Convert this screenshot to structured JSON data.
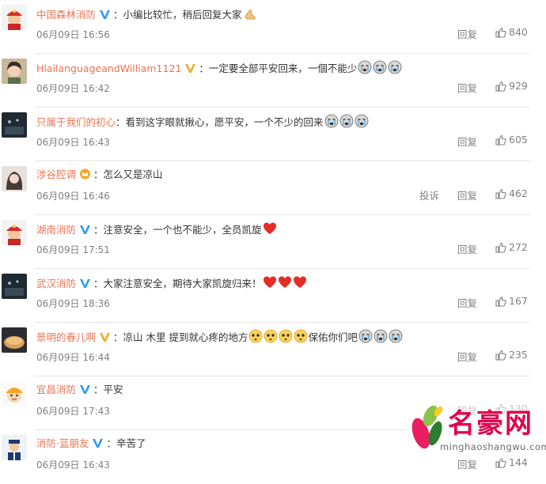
{
  "comments": [
    {
      "user": "中国森林消防",
      "verified": "blue",
      "text": "：小编比较忙，稍后回复大家",
      "emoji": [
        "pray"
      ],
      "time": "06月09日 16:56",
      "report": "",
      "reply": "回复",
      "likes": "840",
      "avatar": "firefighter"
    },
    {
      "user": "HlailanguageandWilliam1121",
      "verified": "gold",
      "text": "：一定要全部平安回来，一個不能少",
      "emoji": [
        "sob",
        "sob",
        "sob"
      ],
      "time": "06月09日 16:42",
      "reply": "回复",
      "likes": "929",
      "avatar": "girl"
    },
    {
      "user": "只属于我们的初心",
      "verified": "",
      "text": "：看到这字眼就揪心，愿平安，一个不少的回来",
      "emoji": [
        "sob",
        "sob",
        "sob"
      ],
      "time": "06月09日 16:43",
      "reply": "回复",
      "likes": "605",
      "avatar": "dark"
    },
    {
      "user": "涉谷腔调",
      "verified": "crown",
      "text": "：怎么又是凉山",
      "emoji": [],
      "time": "06月09日 16:46",
      "report": "投诉",
      "reply": "回复",
      "likes": "462",
      "avatar": "portrait"
    },
    {
      "user": "湖南消防",
      "verified": "blue",
      "text": "：注意安全，一个也不能少，全员凯旋",
      "emoji": [
        "heart"
      ],
      "time": "06月09日 17:51",
      "reply": "回复",
      "likes": "272",
      "avatar": "firefighter"
    },
    {
      "user": "武汉消防",
      "verified": "blue",
      "text": "：大家注意安全，期待大家凯旋归来！",
      "emoji": [
        "heart",
        "heart",
        "heart"
      ],
      "time": "06月09日 18:36",
      "reply": "回复",
      "likes": "167",
      "avatar": "dark"
    },
    {
      "user": "景明的春儿啊",
      "verified": "gold",
      "text": "：凉山 木里 提到就心疼的地方",
      "emoji": [
        "worried",
        "worried",
        "worried",
        "worried"
      ],
      "text2": "保佑你们吧",
      "emoji2": [
        "sob",
        "sob",
        "sob"
      ],
      "time": "06月09日 16:44",
      "reply": "回复",
      "likes": "235",
      "avatar": "bread"
    },
    {
      "user": "宜昌消防",
      "verified": "blue",
      "text": "：平安",
      "emoji": [],
      "time": "06月09日 17:43",
      "reply": "回复",
      "likes": "130",
      "avatar": "cartoon"
    },
    {
      "user": "消防·蓝朋友",
      "verified": "blue",
      "text": "：辛苦了",
      "emoji": [],
      "time": "06月09日 16:43",
      "reply": "回复",
      "likes": "144",
      "avatar": "officer"
    }
  ],
  "watermark": {
    "brand": "名豪网",
    "url": "minghaoshangwu.com"
  },
  "colors": {
    "username": "#eb7350",
    "blue_v": "#2d9bf0",
    "gold_v": "#f5a623",
    "text": "#333333",
    "meta": "#808080"
  }
}
